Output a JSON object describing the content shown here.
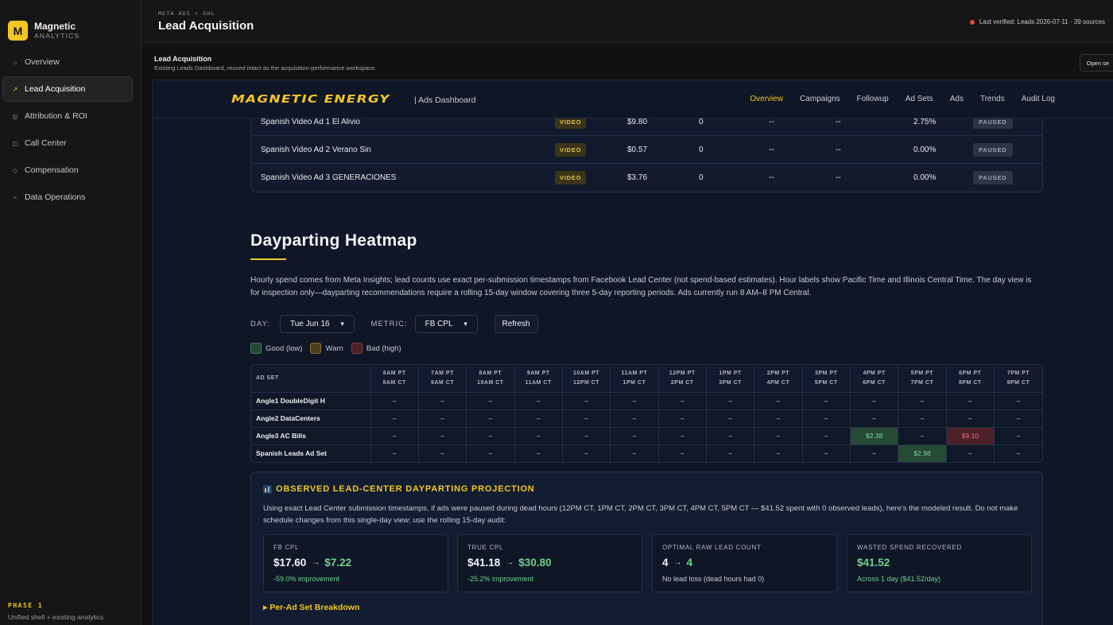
{
  "sidebar": {
    "brand_initial": "M",
    "brand_name": "Magnetic",
    "brand_sub": "ANALYTICS",
    "items": [
      {
        "label": "Overview",
        "icon": "⌂"
      },
      {
        "label": "Lead Acquisition",
        "icon": "↗"
      },
      {
        "label": "Attribution & ROI",
        "icon": "◎"
      },
      {
        "label": "Call Center",
        "icon": "◫"
      },
      {
        "label": "Compensation",
        "icon": "◇"
      },
      {
        "label": "Data Operations",
        "icon": "⌁"
      }
    ],
    "phase": "PHASE 1",
    "phase_sub": "Unified shell + existing analytics"
  },
  "topbar": {
    "eyebrow": "META ADS + GHL",
    "title": "Lead Acquisition",
    "verified": "Last verified: Leads 2026-07-11 · 39 sources"
  },
  "subheader": {
    "title": "Lead Acquisition",
    "desc": "Existing Leads Dashboard, reused intact as the acquisition-performance workspace.",
    "open_btn": "Open se"
  },
  "dashboard": {
    "logo": "MAGNETIC ENERGY",
    "sub": "| Ads Dashboard",
    "tabs": [
      "Overview",
      "Campaigns",
      "Followup",
      "Ad Sets",
      "Ads",
      "Trends",
      "Audit Log"
    ],
    "active_tab": "Overview"
  },
  "ads_rows": [
    {
      "name": "Spanish Video Ad 1 El Alivio",
      "type": "VIDEO",
      "spend": "$9.80",
      "leads": "0",
      "d1": "--",
      "d2": "--",
      "pct": "2.75%",
      "status": "PAUSED"
    },
    {
      "name": "Spanish Video Ad 2 Verano Sin",
      "type": "VIDEO",
      "spend": "$0.57",
      "leads": "0",
      "d1": "--",
      "d2": "--",
      "pct": "0.00%",
      "status": "PAUSED"
    },
    {
      "name": "Spanish Video Ad 3 GENERACIONES",
      "type": "VIDEO",
      "spend": "$3.76",
      "leads": "0",
      "d1": "--",
      "d2": "--",
      "pct": "0.00%",
      "status": "PAUSED"
    }
  ],
  "heatmap_section": {
    "title": "Dayparting Heatmap",
    "intro": "Hourly spend comes from Meta Insights; lead counts use exact per-submission timestamps from Facebook Lead Center (not spend-based estimates). Hour labels show Pacific Time and Illinois Central Time. The day view is for inspection only—dayparting recommendations require a rolling 15-day window covering three 5-day reporting periods. Ads currently run 8 AM–8 PM Central.",
    "day_label": "DAY:",
    "day_value": "Tue Jun 16",
    "metric_label": "METRIC:",
    "metric_value": "FB CPL",
    "refresh": "Refresh",
    "legend": [
      {
        "label": "Good (low)",
        "color": "#264a36",
        "border": "#3f7a55"
      },
      {
        "label": "Warn",
        "color": "#4a3f1c",
        "border": "#8a7430"
      },
      {
        "label": "Bad (high)",
        "color": "#4c2129",
        "border": "#8a3a45"
      }
    ]
  },
  "heatmap": {
    "corner": "AD SET",
    "hours": [
      {
        "pt": "6AM PT",
        "ct": "8AM CT"
      },
      {
        "pt": "7AM PT",
        "ct": "9AM CT"
      },
      {
        "pt": "8AM PT",
        "ct": "10AM CT"
      },
      {
        "pt": "9AM PT",
        "ct": "11AM CT"
      },
      {
        "pt": "10AM PT",
        "ct": "12PM CT"
      },
      {
        "pt": "11AM PT",
        "ct": "1PM CT"
      },
      {
        "pt": "12PM PT",
        "ct": "2PM CT"
      },
      {
        "pt": "1PM PT",
        "ct": "3PM CT"
      },
      {
        "pt": "2PM PT",
        "ct": "4PM CT"
      },
      {
        "pt": "3PM PT",
        "ct": "5PM CT"
      },
      {
        "pt": "4PM PT",
        "ct": "6PM CT"
      },
      {
        "pt": "5PM PT",
        "ct": "7PM CT"
      },
      {
        "pt": "6PM PT",
        "ct": "8PM CT"
      },
      {
        "pt": "7PM PT",
        "ct": "9PM CT"
      }
    ],
    "rows": [
      {
        "name": "Angle1 DoubleDigit H",
        "cells": [
          {
            "v": "–"
          },
          {
            "v": "–"
          },
          {
            "v": "–"
          },
          {
            "v": "–"
          },
          {
            "v": "–"
          },
          {
            "v": "–"
          },
          {
            "v": "–"
          },
          {
            "v": "–"
          },
          {
            "v": "–"
          },
          {
            "v": "–"
          },
          {
            "v": "–"
          },
          {
            "v": "–"
          },
          {
            "v": "–"
          },
          {
            "v": "–"
          }
        ]
      },
      {
        "name": "Angle2 DataCenters",
        "cells": [
          {
            "v": "–"
          },
          {
            "v": "–"
          },
          {
            "v": "–"
          },
          {
            "v": "–"
          },
          {
            "v": "–"
          },
          {
            "v": "–"
          },
          {
            "v": "–"
          },
          {
            "v": "–"
          },
          {
            "v": "–"
          },
          {
            "v": "–"
          },
          {
            "v": "–"
          },
          {
            "v": "–"
          },
          {
            "v": "–"
          },
          {
            "v": "–"
          }
        ]
      },
      {
        "name": "Angle3 AC Bills",
        "cells": [
          {
            "v": "–"
          },
          {
            "v": "–"
          },
          {
            "v": "–"
          },
          {
            "v": "–"
          },
          {
            "v": "–"
          },
          {
            "v": "–"
          },
          {
            "v": "–"
          },
          {
            "v": "–"
          },
          {
            "v": "–"
          },
          {
            "v": "–"
          },
          {
            "v": "$2.38",
            "s": "good"
          },
          {
            "v": "–"
          },
          {
            "v": "$9.10",
            "s": "bad"
          },
          {
            "v": "–"
          }
        ]
      },
      {
        "name": "Spanish Leads Ad Set",
        "cells": [
          {
            "v": "–"
          },
          {
            "v": "–"
          },
          {
            "v": "–"
          },
          {
            "v": "–"
          },
          {
            "v": "–"
          },
          {
            "v": "–"
          },
          {
            "v": "–"
          },
          {
            "v": "–"
          },
          {
            "v": "–"
          },
          {
            "v": "–"
          },
          {
            "v": "–"
          },
          {
            "v": "$2.98",
            "s": "good"
          },
          {
            "v": "–"
          },
          {
            "v": "–"
          }
        ]
      }
    ]
  },
  "projection": {
    "title": "OBSERVED LEAD-CENTER DAYPARTING PROJECTION",
    "desc": "Using exact Lead Center submission timestamps, if ads were paused during dead hours (12PM CT, 1PM CT, 2PM CT, 3PM CT, 4PM CT, 5PM CT — $41.52 spent with 0 observed leads), here's the modeled result. Do not make schedule changes from this single-day view; use the rolling 15-day audit:",
    "metrics": [
      {
        "label": "FB CPL",
        "old": "$17.60",
        "arrow": "→",
        "new": "$7.22",
        "note": "-59.0% improvement",
        "note_green": true
      },
      {
        "label": "TRUE CPL",
        "old": "$41.18",
        "arrow": "→",
        "new": "$30.80",
        "note": "-25.2% improvement",
        "note_green": true
      },
      {
        "label": "OPTIMAL RAW LEAD COUNT",
        "old": "4",
        "arrow": "→",
        "new": "4",
        "note": "No lead loss (dead hours had 0)",
        "note_green": false
      },
      {
        "label": "WASTED SPEND RECOVERED",
        "old": "",
        "arrow": "",
        "new": "$41.52",
        "note": "Across 1 day ($41.52/day)",
        "note_green": true
      }
    ],
    "breakdown": "▸ Per-Ad Set Breakdown"
  }
}
